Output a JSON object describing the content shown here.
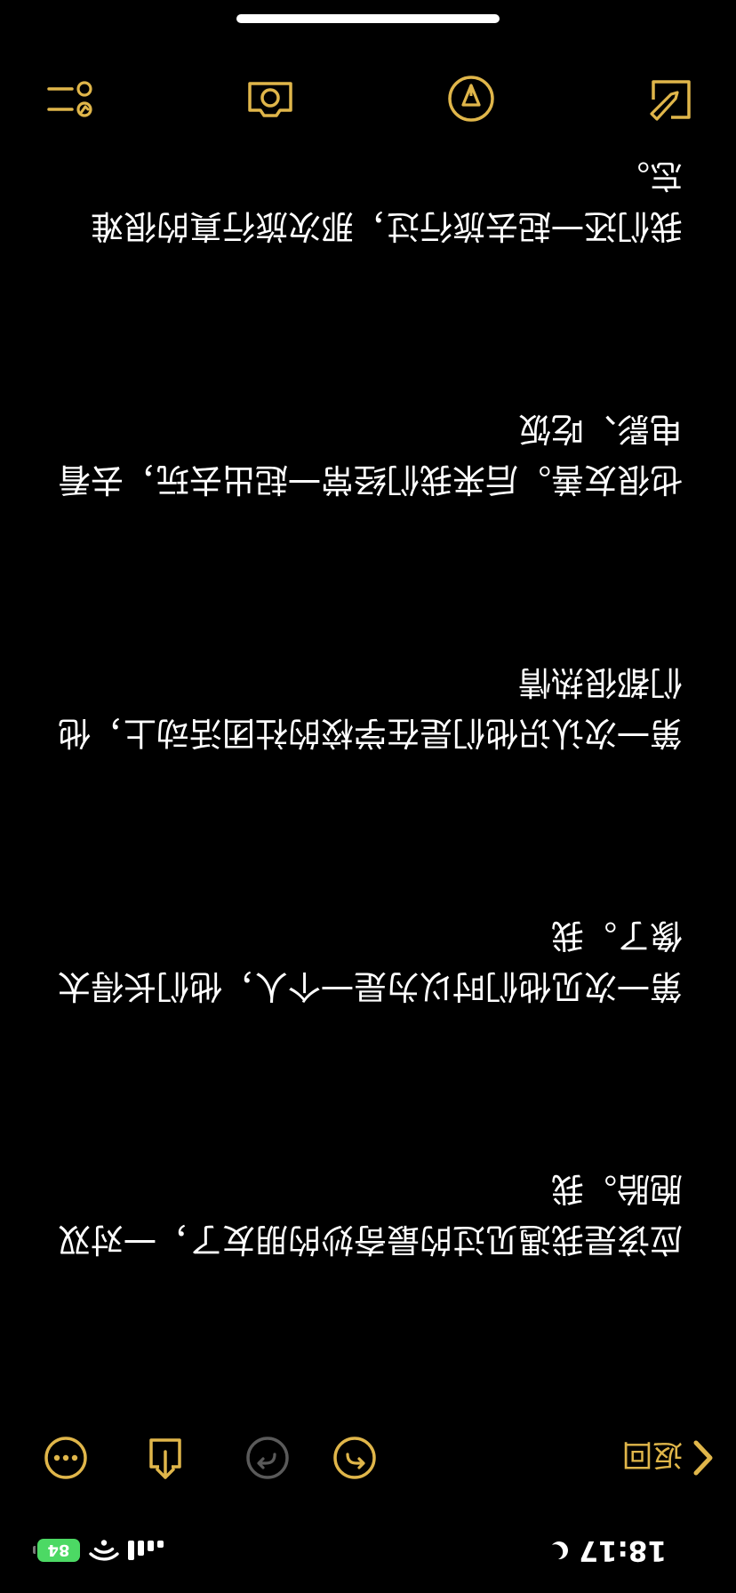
{
  "status_bar": {
    "time": "18:17",
    "battery": "84"
  },
  "toolbar": {
    "back_label": "返回"
  },
  "note": {
    "paragraphs": [
      "应该是我遇见过的最奇妙的朋友了，一对双胞胎。我",
      "第一次见他们时以为是一个人，他们长得太像了。我",
      "第一次认识他们是在学校的社团活动上，他们都很热情",
      "也很友善。后来我们经常一起出去玩，去看电影、吃饭",
      "我们还一起去旅行过，那次旅行真的很难忘。"
    ]
  },
  "colors": {
    "accent": "#e0b64a",
    "background": "#000000",
    "text": "#ffffff",
    "battery": "#4cd964"
  },
  "icons": {
    "back": "chevron-left-icon",
    "undo": "undo-icon",
    "redo": "redo-icon",
    "share": "share-icon",
    "more": "more-icon",
    "checklist": "checklist-icon",
    "camera": "camera-icon",
    "markup": "markup-pen-icon",
    "compose": "compose-icon"
  }
}
